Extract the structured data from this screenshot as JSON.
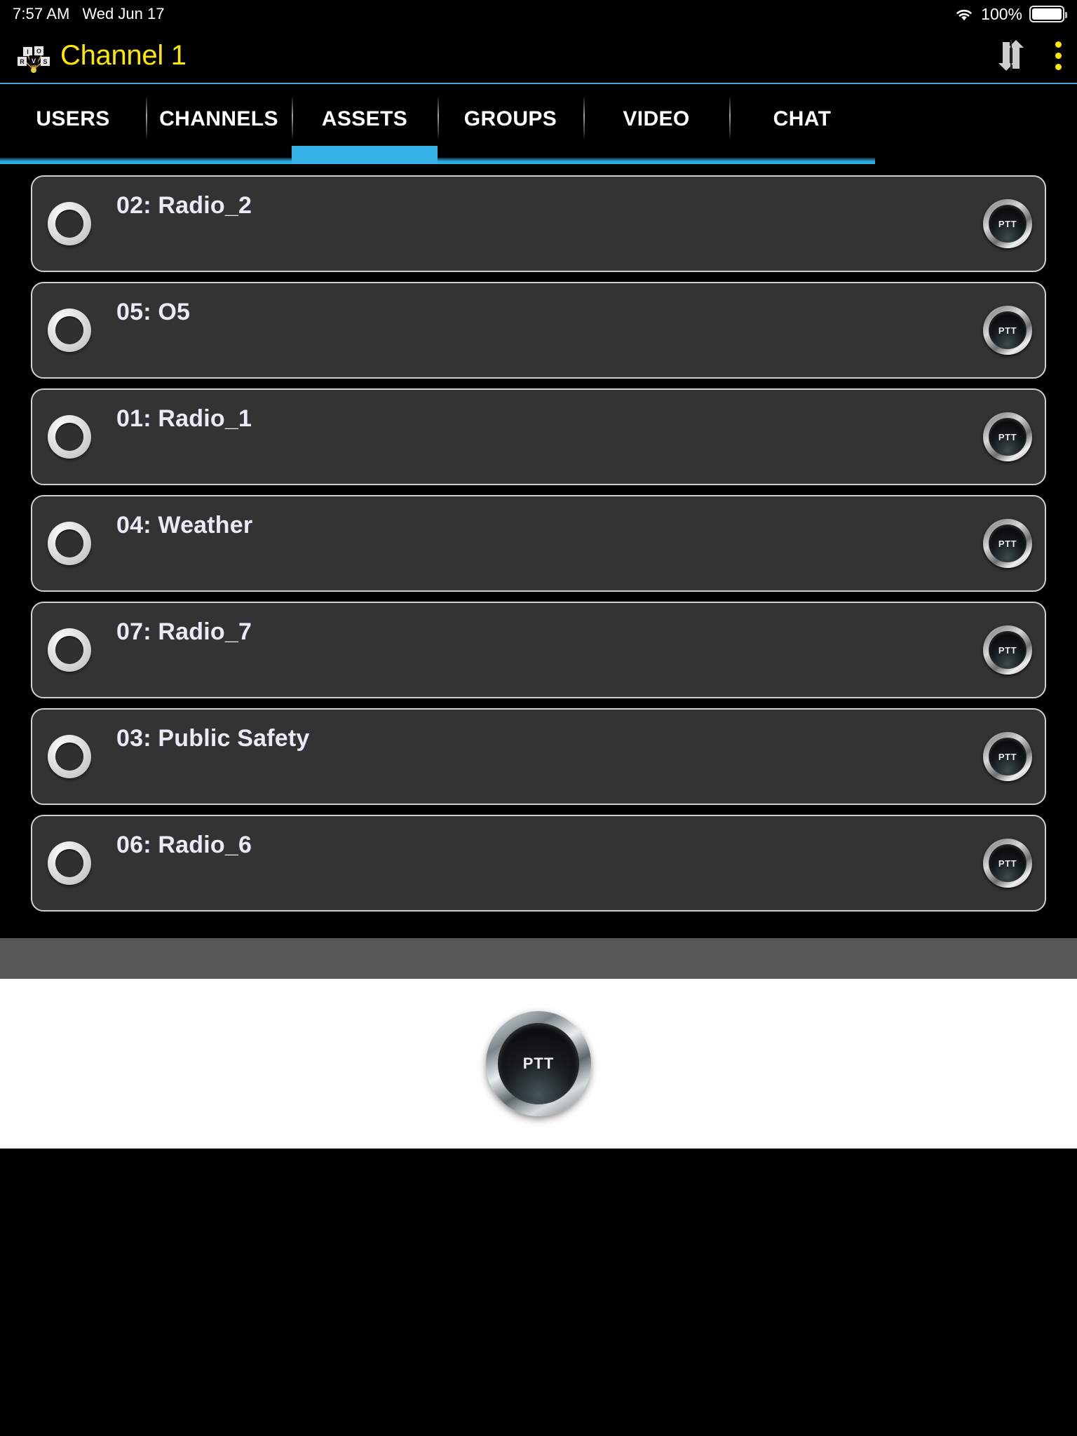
{
  "status_bar": {
    "time": "7:57 AM",
    "date": "Wed Jun 17",
    "battery_percent": "100%",
    "wifi_icon": "wifi-icon",
    "battery_icon": "battery-icon"
  },
  "header": {
    "logo_icon": "riosv-logo-icon",
    "title": "Channel 1",
    "title_color": "#ffe800",
    "swap_icon": "swap-vertical-arrows-icon",
    "overflow_icon": "kebab-menu-icon",
    "accent_color": "#3aa7d6"
  },
  "tabs": {
    "active_index": 2,
    "active_color": "#35b2e8",
    "items": [
      {
        "label": "USERS"
      },
      {
        "label": "CHANNELS"
      },
      {
        "label": "ASSETS"
      },
      {
        "label": "GROUPS"
      },
      {
        "label": "VIDEO"
      },
      {
        "label": "CHAT"
      }
    ]
  },
  "assets": {
    "ptt_label": "PTT",
    "rows": [
      {
        "label": "02: Radio_2"
      },
      {
        "label": "05: O5"
      },
      {
        "label": "01: Radio_1"
      },
      {
        "label": "04: Weather"
      },
      {
        "label": "07: Radio_7"
      },
      {
        "label": "03: Public Safety"
      },
      {
        "label": "06: Radio_6"
      }
    ]
  },
  "footer": {
    "ptt_label": "PTT"
  }
}
